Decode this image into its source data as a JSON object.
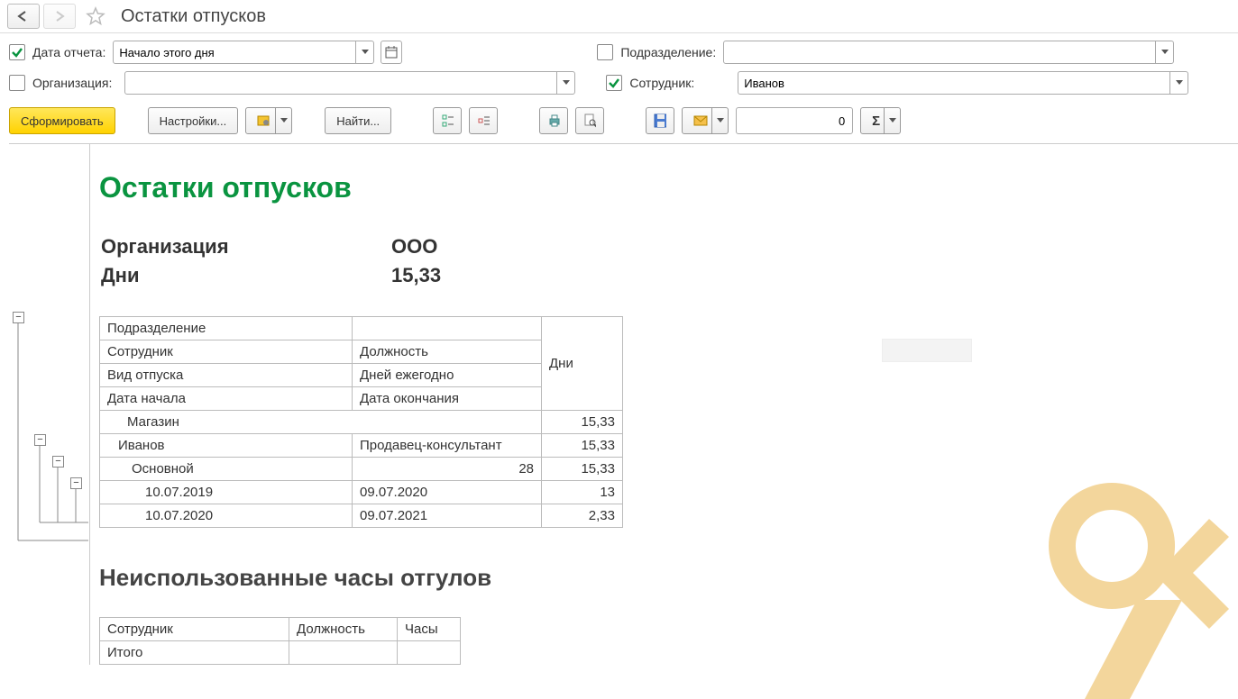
{
  "header": {
    "title": "Остатки отпусков"
  },
  "filters": {
    "report_date": {
      "enabled": true,
      "label": "Дата отчета:",
      "value": "Начало этого дня"
    },
    "department": {
      "enabled": false,
      "label": "Подразделение:",
      "value": ""
    },
    "organization": {
      "enabled": false,
      "label": "Организация:",
      "value": ""
    },
    "employee": {
      "enabled": true,
      "label": "Сотрудник:",
      "value": "Иванов"
    }
  },
  "toolbar": {
    "generate": "Сформировать",
    "settings": "Настройки...",
    "find": "Найти...",
    "number_value": "0"
  },
  "report": {
    "title": "Остатки отпусков",
    "summary": {
      "org_label": "Организация",
      "org_value": "ООО",
      "days_label": "Дни",
      "days_value": "15,33"
    },
    "table1": {
      "hdr_dept": "Подразделение",
      "hdr_days": "Дни",
      "hdr_emp": "Сотрудник",
      "hdr_pos": "Должность",
      "hdr_type": "Вид отпуска",
      "hdr_yearly": "Дней ежегодно",
      "hdr_start": "Дата начала",
      "hdr_end": "Дата окончания",
      "l1_dept": "Магазин",
      "l1_days": "15,33",
      "l2_emp": "Иванов",
      "l2_pos": "Продавец-консультант",
      "l2_days": "15,33",
      "l3_type": "Основной",
      "l3_yearly": "28",
      "l3_days": "15,33",
      "r1_start": "10.07.2019",
      "r1_end": "09.07.2020",
      "r1_days": "13",
      "r2_start": "10.07.2020",
      "r2_end": "09.07.2021",
      "r2_days": "2,33"
    },
    "section2_title": "Неиспользованные часы отгулов",
    "table2": {
      "hdr_emp": "Сотрудник",
      "hdr_pos": "Должность",
      "hdr_hours": "Часы",
      "total": "Итого"
    }
  }
}
